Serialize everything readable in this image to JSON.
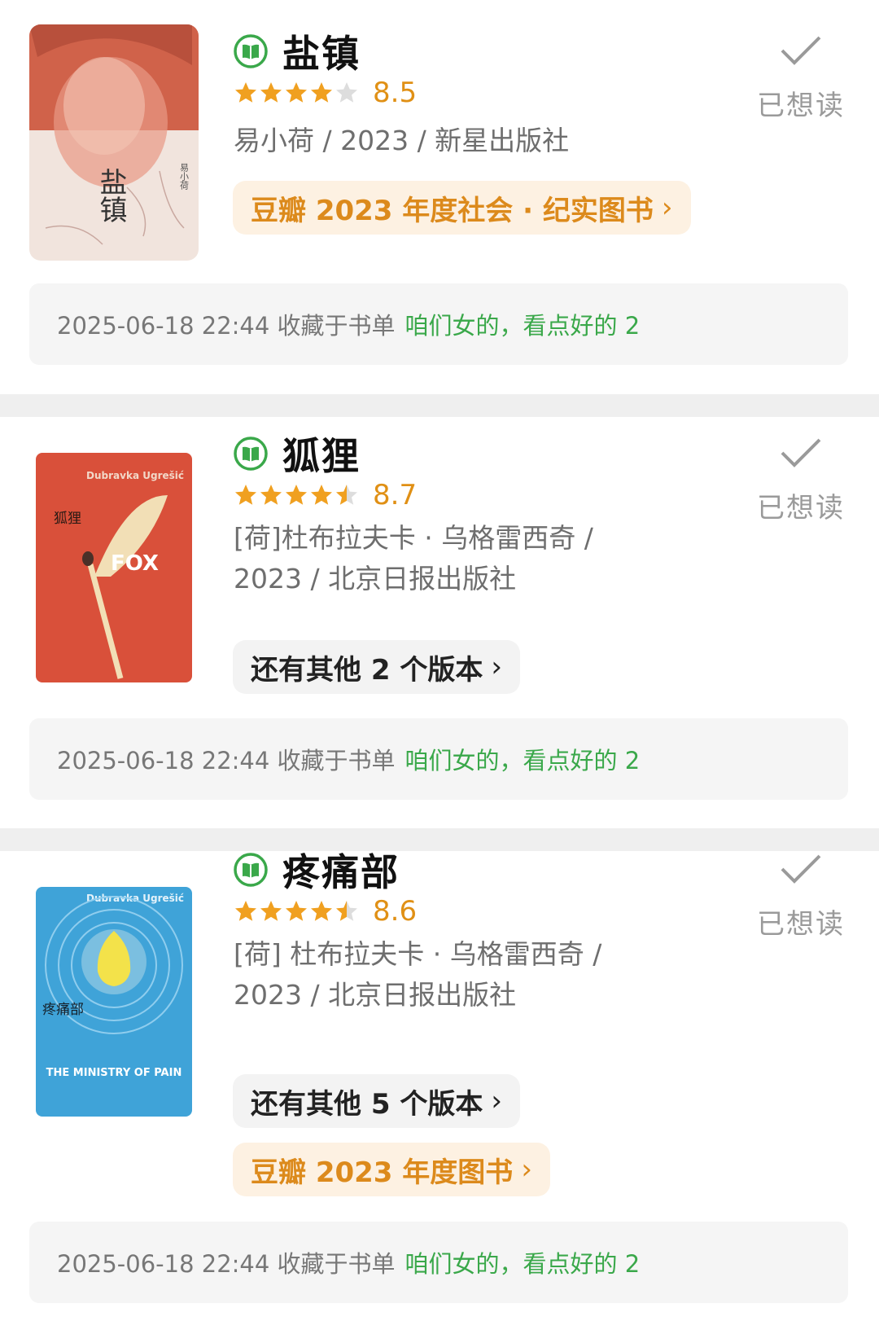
{
  "want_label": "已想读",
  "colors": {
    "accent_green": "#3aa84a",
    "star_orange": "#f0a020",
    "score_orange": "#e09015",
    "award_bg": "#fdf1e2"
  },
  "books": [
    {
      "title": "盐镇",
      "rating": 8.5,
      "stars": 4,
      "score": "8.5",
      "meta": "易小荷 / 2023 / 新星出版社",
      "award": "豆瓣 2023 年度社会 · 纪实图书",
      "collect_prefix": "2025-06-18 22:44 收藏于书单",
      "list_name": "咱们女的，看点好的 2",
      "cover_text": "盐镇",
      "cover_author": "易小荷"
    },
    {
      "title": "狐狸",
      "rating": 8.7,
      "stars": 4.5,
      "score": "8.7",
      "meta": "[荷]杜布拉夫卡 · 乌格雷西奇 / 2023 / 北京日报出版社",
      "editions": "还有其他 2 个版本",
      "collect_prefix": "2025-06-18 22:44 收藏于书单",
      "list_name": "咱们女的，看点好的 2",
      "cover_author": "Dubravka Ugrešić",
      "cover_title": "狐狸",
      "cover_en": "FOX"
    },
    {
      "title": "疼痛部",
      "rating": 8.6,
      "stars": 4.5,
      "score": "8.6",
      "meta": "[荷] 杜布拉夫卡 · 乌格雷西奇 / 2023 / 北京日报出版社",
      "editions": "还有其他 5 个版本",
      "award": "豆瓣 2023 年度图书",
      "collect_prefix": "2025-06-18 22:44 收藏于书单",
      "list_name": "咱们女的，看点好的 2",
      "cover_author": "Dubravka Ugrešić",
      "cover_title": "疼痛部",
      "cover_en": "THE MINISTRY OF PAIN"
    }
  ]
}
